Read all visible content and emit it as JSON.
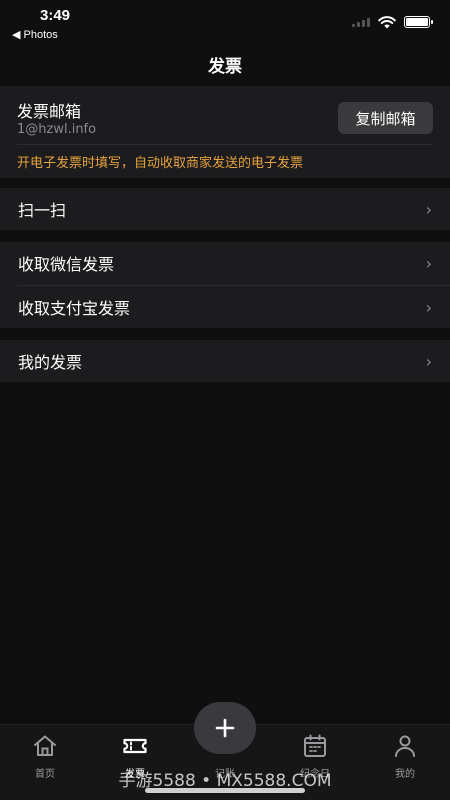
{
  "status_bar": {
    "time": "3:49",
    "back_label": "◀ Photos",
    "battery_level": 1.0
  },
  "header": {
    "title": "发票"
  },
  "email_section": {
    "label": "发票邮箱",
    "email": "1@hzwl.info",
    "copy_button_label": "复制邮箱",
    "hint": "开电子发票时填写，自动收取商家发送的电子发票",
    "hint_color": "#e6a23c"
  },
  "menu": {
    "scan": "扫一扫",
    "wechat": "收取微信发票",
    "alipay": "收取支付宝发票",
    "mine": "我的发票",
    "chevron": "›"
  },
  "tab_bar": {
    "items": [
      {
        "label": "首页",
        "icon": "home-icon"
      },
      {
        "label": "发票",
        "icon": "ticket-icon",
        "active": true
      },
      {
        "label": "记账",
        "icon": "plus-icon"
      },
      {
        "label": "纪念日",
        "icon": "calendar-icon"
      },
      {
        "label": "我的",
        "icon": "person-icon"
      }
    ]
  },
  "watermark": "手游5588 • MX5588.COM"
}
